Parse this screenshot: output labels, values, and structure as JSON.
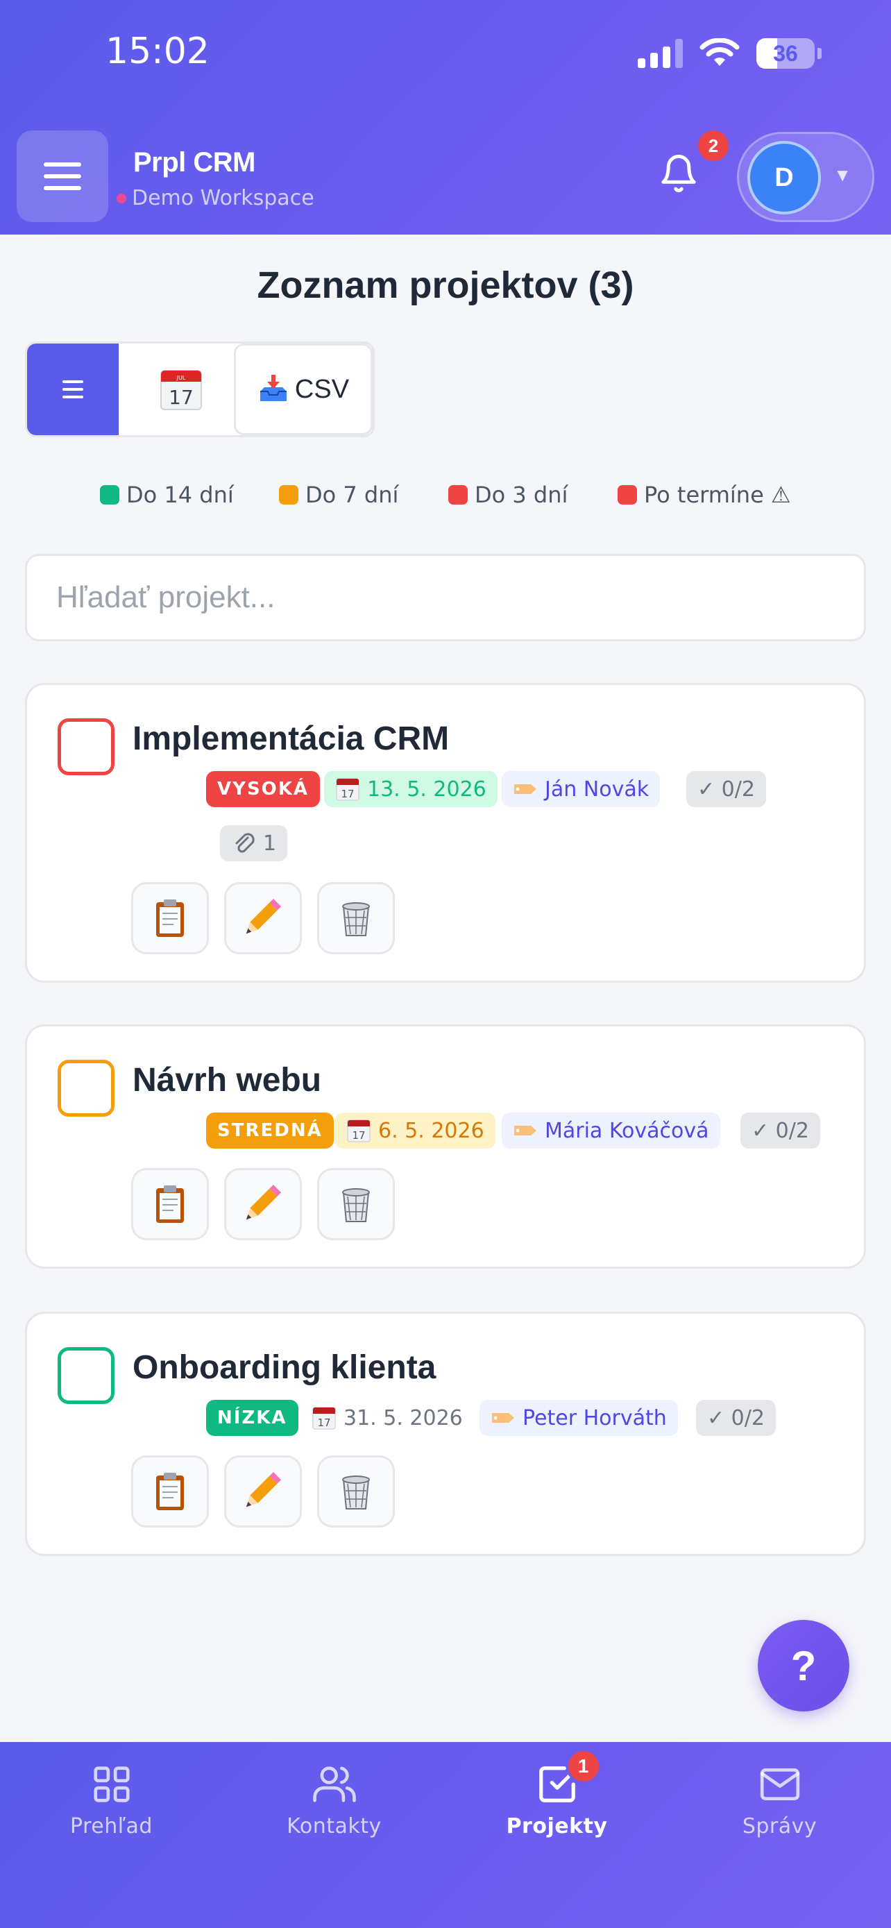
{
  "status_bar": {
    "time": "15:02",
    "battery": "36",
    "battery_level": 0.36
  },
  "header": {
    "app_title": "Prpl CRM",
    "workspace": "Demo Workspace",
    "notifications_count": "2",
    "user_initial": "D"
  },
  "page": {
    "title": "Zoznam projektov (3)",
    "csv_label": "CSV",
    "search_placeholder": "Hľadať projekt..."
  },
  "legend": [
    {
      "label": "Do 14 dní",
      "color": "#10b981"
    },
    {
      "label": "Do 7 dní",
      "color": "#f59e0b"
    },
    {
      "label": "Do 3 dní",
      "color": "#ef4444"
    },
    {
      "label": "Po termíne ⚠",
      "color": "#ef4444"
    }
  ],
  "projects": [
    {
      "title": "Implementácia CRM",
      "priority": "VYSOKÁ",
      "priority_color": "#ef4444",
      "check_color": "#ef4444",
      "date": "13. 5. 2026",
      "owner": "Ján Novák",
      "tasks": "✓ 0/2",
      "attachments": "1"
    },
    {
      "title": "Návrh webu",
      "priority": "STREDNÁ",
      "priority_color": "#f59e0b",
      "check_color": "#f59e0b",
      "date": "6. 5. 2026",
      "owner": "Mária Kováčová",
      "tasks": "✓ 0/2"
    },
    {
      "title": "Onboarding klienta",
      "priority": "NÍZKA",
      "priority_color": "#10b981",
      "check_color": "#10b981",
      "date": "31. 5. 2026",
      "owner": "Peter Horváth",
      "tasks": "✓ 0/2"
    }
  ],
  "help_label": "?",
  "bottom_nav": [
    {
      "label": "Prehľad",
      "icon": "grid-icon"
    },
    {
      "label": "Kontakty",
      "icon": "users-icon"
    },
    {
      "label": "Projekty",
      "icon": "check-square-icon",
      "badge": "1",
      "active": true
    },
    {
      "label": "Správy",
      "icon": "mail-icon"
    }
  ],
  "colors": {
    "brand": "#5b5be9",
    "accent": "#7762f2"
  }
}
